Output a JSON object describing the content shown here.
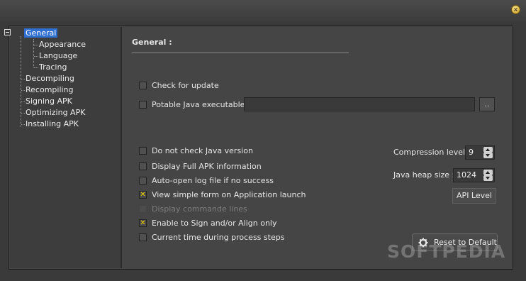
{
  "tree": {
    "items": [
      {
        "label": "General",
        "selected": true
      },
      {
        "label": "Appearance"
      },
      {
        "label": "Language"
      },
      {
        "label": "Tracing"
      },
      {
        "label": "Decompiling"
      },
      {
        "label": "Recompiling"
      },
      {
        "label": "Signing APK"
      },
      {
        "label": "Optimizing APK"
      },
      {
        "label": "Installing APK"
      }
    ]
  },
  "panel": {
    "title": "General :",
    "check_update": {
      "label": "Check for update",
      "checked": false
    },
    "potable_java": {
      "label": "Potable Java executable :",
      "checked": false,
      "value": ""
    },
    "browse_label": "..",
    "options": [
      {
        "label": "Do not check Java version",
        "checked": false
      },
      {
        "label": "Display Full APK information",
        "checked": false
      },
      {
        "label": "Auto-open log file if no success",
        "checked": false
      },
      {
        "label": "View simple form on Application launch",
        "checked": true
      },
      {
        "label": "Display commande lines",
        "checked": false,
        "disabled": true
      },
      {
        "label": "Enable to Sign and/or Align only",
        "checked": true
      },
      {
        "label": "Current time during process steps",
        "checked": false
      }
    ],
    "compression": {
      "label": "Compression level :",
      "value": "9"
    },
    "heap": {
      "label": "Java heap size :",
      "value": "1024"
    },
    "api_level_label": "API Level",
    "reset_label": "Reset to Default"
  },
  "checked_glyph": "✕",
  "watermark": "SOFTPEDIA",
  "colors": {
    "accent": "#2f6fd0",
    "check": "#f0d000"
  }
}
